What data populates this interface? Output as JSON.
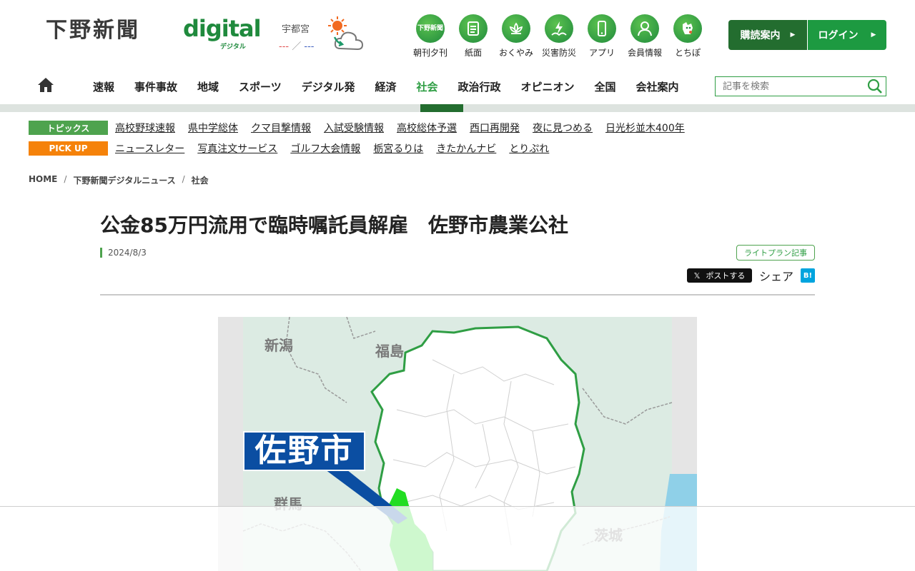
{
  "header": {
    "logo_ja": "下野新聞",
    "logo_en": "digital",
    "logo_sub": "デジタル",
    "weather": {
      "city": "宇都宮",
      "temp_high": "---",
      "temp_sep": "／",
      "temp_low": "---",
      "icon": "sun-cloud-icon"
    },
    "quick_nav": [
      {
        "label": "朝刊夕刊",
        "icon": "newspaper-icon",
        "mini": "下野新聞"
      },
      {
        "label": "紙面",
        "icon": "paper-icon"
      },
      {
        "label": "おくやみ",
        "icon": "lotus-icon"
      },
      {
        "label": "災害防災",
        "icon": "disaster-icon"
      },
      {
        "label": "アプリ",
        "icon": "smartphone-icon"
      },
      {
        "label": "会員情報",
        "icon": "member-icon"
      },
      {
        "label": "とちぽ",
        "icon": "mascot-icon"
      }
    ],
    "subscribe_label": "購読案内",
    "login_label": "ログイン"
  },
  "nav": {
    "items": [
      "速報",
      "事件事故",
      "地域",
      "スポーツ",
      "デジタル発",
      "経済",
      "社会",
      "政治行政",
      "オピニオン",
      "全国",
      "会社案内"
    ],
    "active": "社会",
    "search_placeholder": "記事を検索"
  },
  "topics": {
    "tag1": "トピックス",
    "links1": [
      "高校野球速報",
      "県中学総体",
      "クマ目撃情報",
      "入試受験情報",
      "高校総体予選",
      "西口再開発",
      "夜に見つめる",
      "日光杉並木400年"
    ],
    "tag2": "PICK UP",
    "links2": [
      "ニュースレター",
      "写真注文サービス",
      "ゴルフ大会情報",
      "栃宮るりは",
      "きたかんナビ",
      "とりぷれ"
    ]
  },
  "breadcrumb": {
    "items": [
      "HOME",
      "下野新聞デジタルニュース",
      "社会"
    ],
    "sep": "/"
  },
  "article": {
    "title": "公金85万円流用で臨時嘱託員解雇　佐野市農業公社",
    "date": "2024/8/3",
    "plan_badge": "ライトプラン記事",
    "post_label": "ポストする",
    "share_label": "シェア",
    "hatena_label": "B!"
  },
  "map": {
    "labels": [
      "新潟",
      "福島",
      "群馬",
      "茨城"
    ],
    "city": "佐野市",
    "colors": {
      "tochigi_border": "#2f9e44",
      "highlight": "#22dd22",
      "sea": "#8fd0e8",
      "land": "#dcebe3",
      "callout": "#0b4ea2"
    }
  },
  "colors": {
    "brand_green": "#1f8a3d",
    "dark_green": "#236d2f",
    "pickup_orange": "#f5820a"
  }
}
